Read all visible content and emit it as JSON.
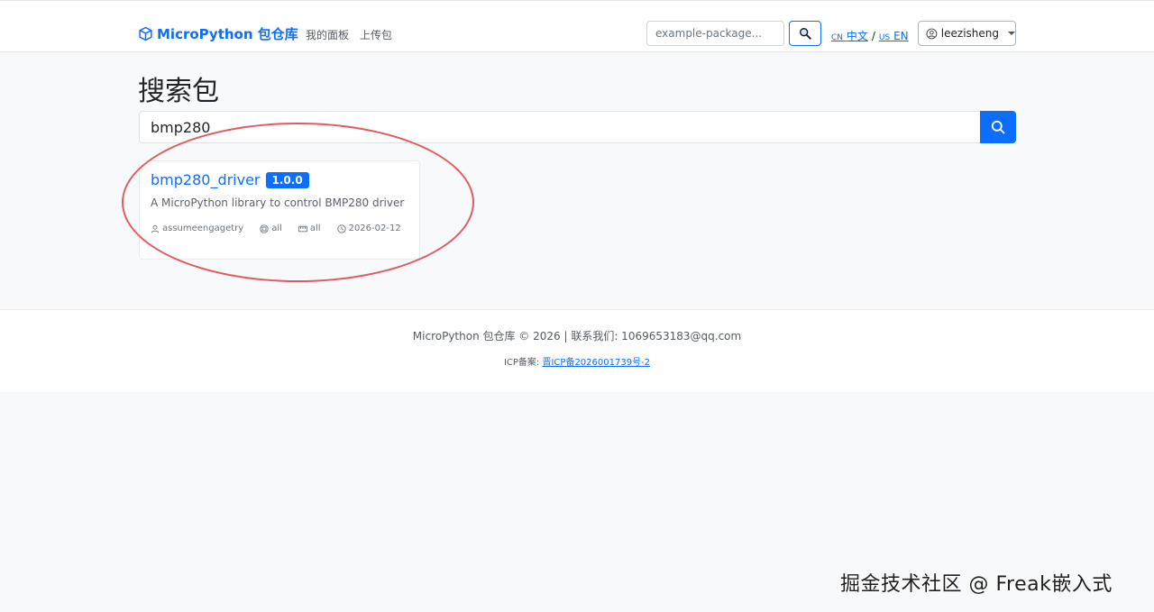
{
  "navbar": {
    "brand": "MicroPython 包仓库",
    "links": [
      "我的面板",
      "上传包"
    ],
    "search_placeholder": "example-package...",
    "lang": {
      "cn_code": "CN",
      "cn_label": "中文",
      "separator": "/",
      "us_code": "US",
      "us_label": "EN"
    },
    "username": "leezisheng"
  },
  "page_title": "搜索包",
  "search": {
    "value": "bmp280"
  },
  "results": [
    {
      "name": "bmp280_driver",
      "version": "1.0.0",
      "description": "A MicroPython library to control BMP280 driver",
      "author": "assumeengagetry",
      "chip": "all",
      "board": "all",
      "date": "2026-02-12"
    }
  ],
  "footer": {
    "line1": "MicroPython 包仓库 © 2026 | 联系我们: 1069653183@qq.com",
    "icp_prefix": "ICP备案:",
    "icp_link": "晋ICP备2026001739号-2"
  },
  "watermark": "掘金技术社区 @ Freak嵌入式",
  "colors": {
    "accent": "#0d6efd",
    "background": "#f8f9fa",
    "annotation": "#e05a5f"
  }
}
